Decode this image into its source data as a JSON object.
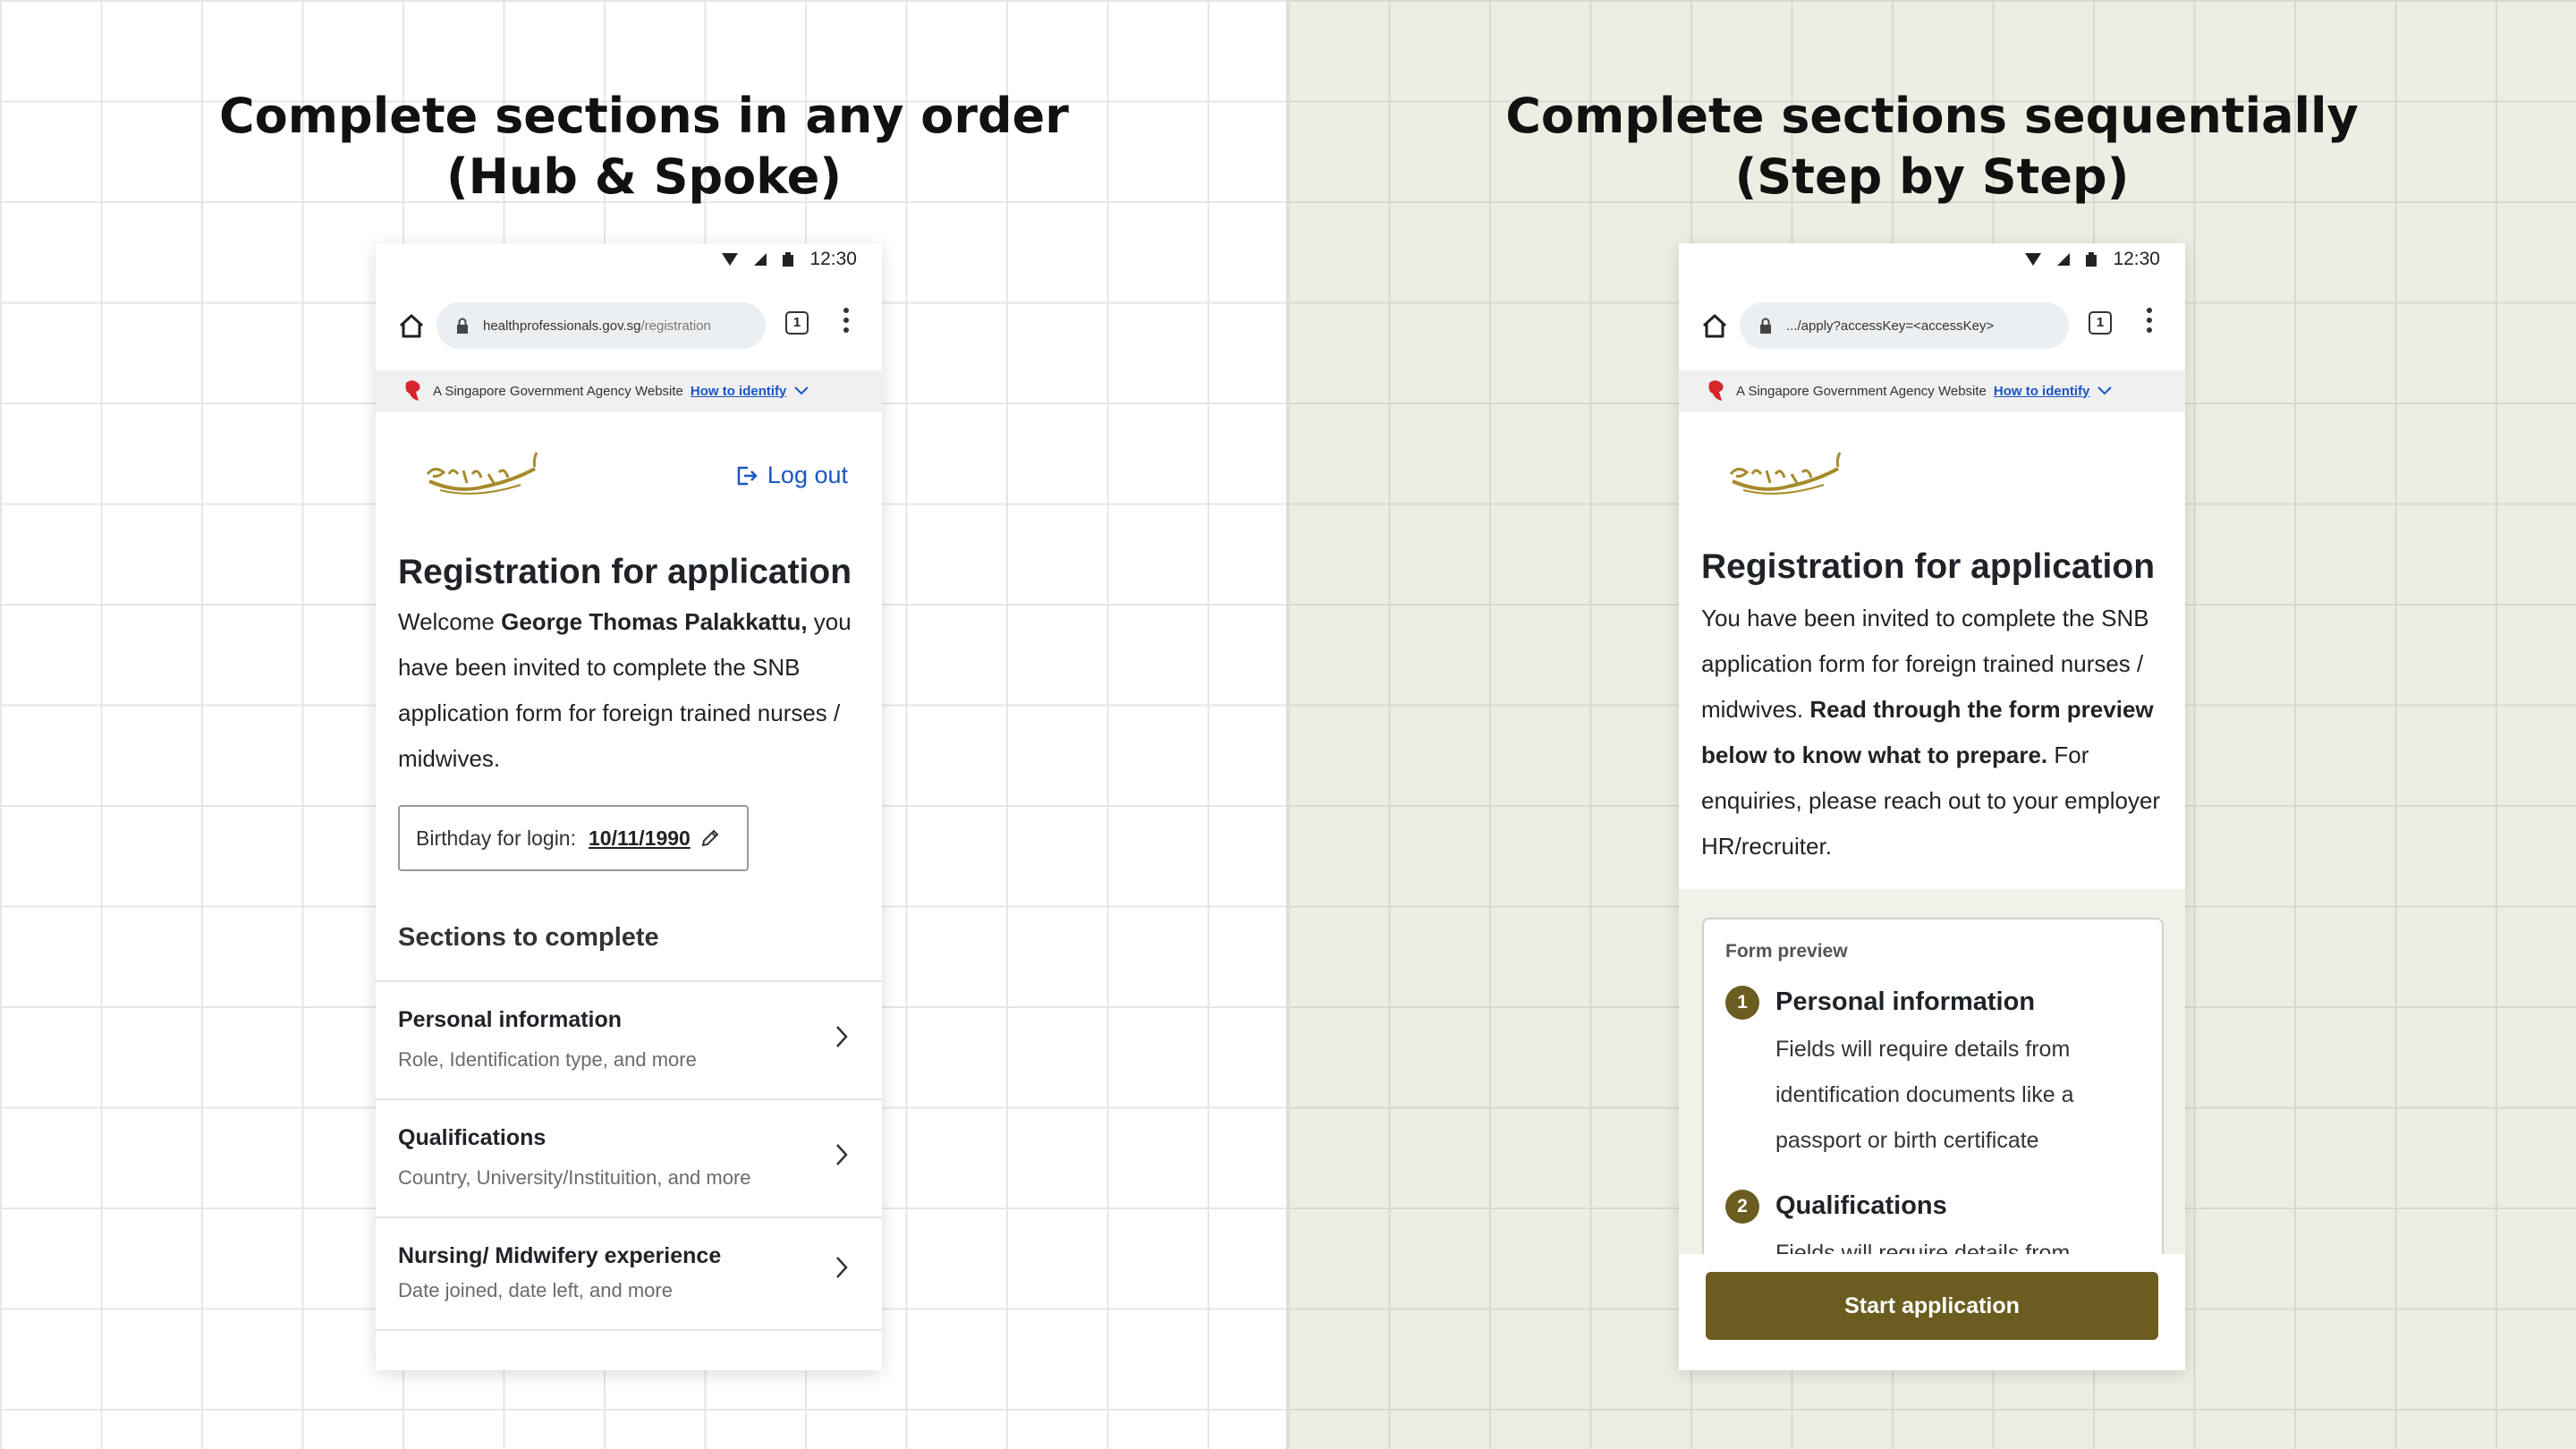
{
  "left": {
    "heading_line1": "Complete sections in any order",
    "heading_line2": "(Hub & Spoke)",
    "status": {
      "time": "12:30"
    },
    "address": {
      "domain": "healthprofessionals.gov.sg",
      "path": "/registration",
      "tab_count": "1"
    },
    "gov_banner": {
      "text": "A Singapore Government Agency Website",
      "link": "How to identify"
    },
    "logout_label": "Log out",
    "page_title": "Registration for application",
    "welcome_prefix": "Welcome ",
    "user_name": "George Thomas Palakkattu,",
    "welcome_rest": " you have been invited to complete the SNB application form for foreign trained nurses / midwives.",
    "birthday": {
      "label": "Birthday for login:",
      "value": "10/11/1990"
    },
    "sections_title": "Sections to complete",
    "sections": [
      {
        "title": "Personal information",
        "subtitle": "Role, Identification type, and more"
      },
      {
        "title": "Qualifications",
        "subtitle": "Country, University/Instituition, and more"
      },
      {
        "title": "Nursing/ Midwifery experience",
        "subtitle": "Date joined, date left, and more"
      }
    ]
  },
  "right": {
    "heading_line1": "Complete sections sequentially",
    "heading_line2": "(Step by Step)",
    "status": {
      "time": "12:30"
    },
    "address": {
      "url": ".../apply?accessKey=<accessKey>",
      "tab_count": "1"
    },
    "gov_banner": {
      "text": "A Singapore Government Agency Website",
      "link": "How to identify"
    },
    "page_title": "Registration for application",
    "intro_1": "You have been invited to complete the SNB application form for foreign trained nurses / midwives. ",
    "intro_bold": "Read through the form preview below to know what to prepare.",
    "intro_2": " For enquiries, please reach out to your employer HR/recruiter.",
    "preview_label": "Form preview",
    "steps": [
      {
        "num": "1",
        "title": "Personal information",
        "desc": "Fields will require details from identification documents like a passport or birth certificate"
      },
      {
        "num": "2",
        "title": "Qualifications",
        "desc": "Fields will require details from"
      }
    ],
    "start_button": "Start application"
  },
  "colors": {
    "accent_olive": "#6b5d20",
    "link_blue": "#1a56c5",
    "right_bg": "#eeede4"
  }
}
